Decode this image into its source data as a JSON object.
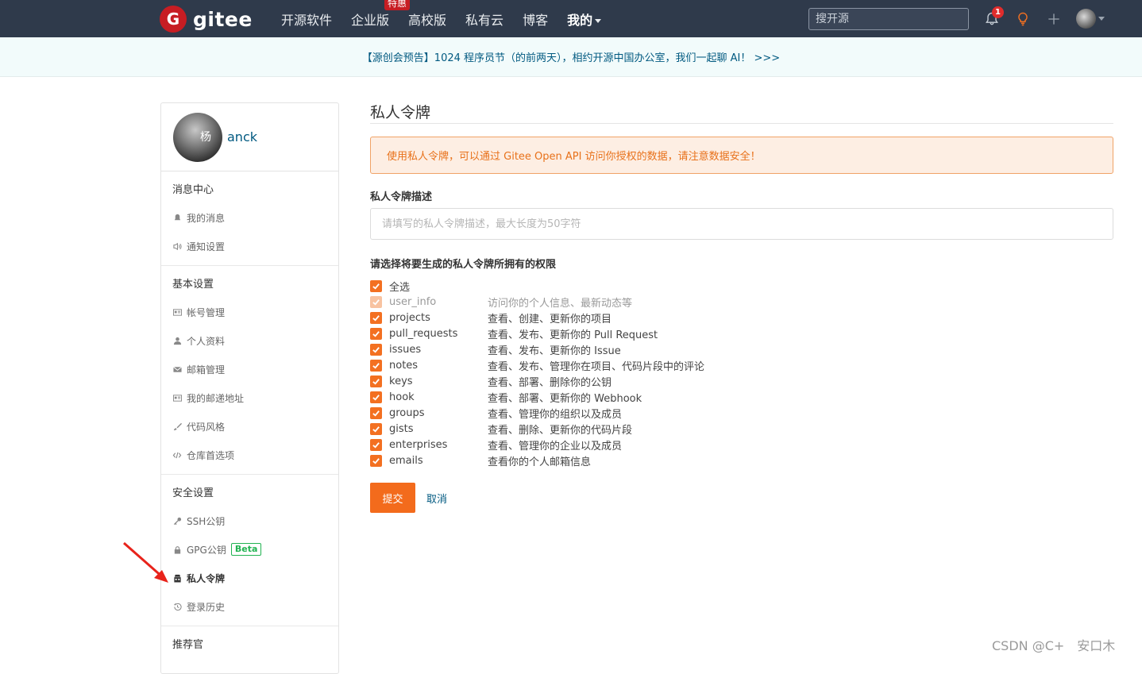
{
  "nav": {
    "logo_letter": "G",
    "logo_text": "gitee",
    "links": [
      {
        "label": "开源软件"
      },
      {
        "label": "企业版",
        "badge": "特惠"
      },
      {
        "label": "高校版"
      },
      {
        "label": "私有云"
      },
      {
        "label": "博客"
      },
      {
        "label": "我的"
      }
    ],
    "search_placeholder": "搜开源",
    "notification_count": "1"
  },
  "announcement": "【源创会预告】1024 程序员节（的前两天），相约开源中国办公室，我们一起聊 AI！ >>>",
  "sidebar": {
    "username": "anck",
    "avatar_text": "杨",
    "sections": [
      {
        "title": "消息中心",
        "items": [
          {
            "label": "我的消息",
            "icon": "bell-icon"
          },
          {
            "label": "通知设置",
            "icon": "speaker-icon"
          }
        ]
      },
      {
        "title": "基本设置",
        "items": [
          {
            "label": "帐号管理",
            "icon": "id-card-icon"
          },
          {
            "label": "个人资料",
            "icon": "user-icon"
          },
          {
            "label": "邮箱管理",
            "icon": "envelope-icon"
          },
          {
            "label": "我的邮递地址",
            "icon": "address-card-icon"
          },
          {
            "label": "代码风格",
            "icon": "brush-icon"
          },
          {
            "label": "仓库首选项",
            "icon": "code-icon"
          }
        ]
      },
      {
        "title": "安全设置",
        "items": [
          {
            "label": "SSH公钥",
            "icon": "key-icon"
          },
          {
            "label": "GPG公钥",
            "icon": "lock-icon",
            "badge": "Beta"
          },
          {
            "label": "私人令牌",
            "icon": "token-icon",
            "active": true
          },
          {
            "label": "登录历史",
            "icon": "history-icon"
          }
        ]
      },
      {
        "title": "推荐官"
      }
    ]
  },
  "main": {
    "title": "私人令牌",
    "alert": "使用私人令牌，可以通过 Gitee Open API 访问你授权的数据，请注意数据安全！",
    "desc_label": "私人令牌描述",
    "desc_placeholder": "请填写的私人令牌描述，最大长度为50字符",
    "perm_label": "请选择将要生成的私人令牌所拥有的权限",
    "select_all": "全选",
    "permissions": [
      {
        "name": "user_info",
        "desc": "访问你的个人信息、最新动态等",
        "disabled": true
      },
      {
        "name": "projects",
        "desc": "查看、创建、更新你的项目"
      },
      {
        "name": "pull_requests",
        "desc": "查看、发布、更新你的 Pull Request"
      },
      {
        "name": "issues",
        "desc": "查看、发布、更新你的 Issue"
      },
      {
        "name": "notes",
        "desc": "查看、发布、管理你在项目、代码片段中的评论"
      },
      {
        "name": "keys",
        "desc": "查看、部署、删除你的公钥"
      },
      {
        "name": "hook",
        "desc": "查看、部署、更新你的 Webhook"
      },
      {
        "name": "groups",
        "desc": "查看、管理你的组织以及成员"
      },
      {
        "name": "gists",
        "desc": "查看、删除、更新你的代码片段"
      },
      {
        "name": "enterprises",
        "desc": "查看、管理你的企业以及成员"
      },
      {
        "name": "emails",
        "desc": "查看你的个人邮箱信息"
      }
    ],
    "submit_label": "提交",
    "cancel_label": "取消"
  },
  "watermark": "CSDN @C+　安口木",
  "colors": {
    "accent": "#f36b1c",
    "navbar": "#2f3a4b",
    "link": "#005980",
    "annotation_arrow": "#e8231b"
  }
}
